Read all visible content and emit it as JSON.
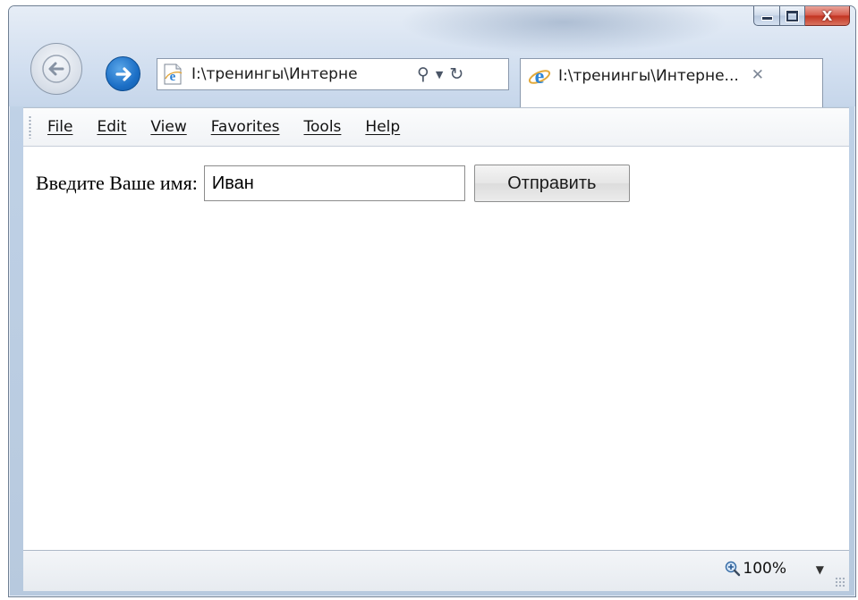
{
  "window": {
    "address_text": "I:\\тренингы\\Интерне",
    "tab_title": "I:\\тренингы\\Интерне...",
    "tab_close_glyph": "✕",
    "caption": {
      "minimize": "",
      "maximize": "",
      "close": "X"
    }
  },
  "menubar": {
    "items": [
      {
        "label": "File"
      },
      {
        "label": "Edit"
      },
      {
        "label": "View"
      },
      {
        "label": "Favorites"
      },
      {
        "label": "Tools"
      },
      {
        "label": "Help"
      }
    ]
  },
  "page": {
    "label": "Введите Ваше имя:",
    "name_value": "Иван",
    "submit_label": "Отправить"
  },
  "statusbar": {
    "zoom": "100%"
  },
  "icons": {
    "back": "back-arrow-icon",
    "forward": "forward-arrow-icon",
    "page": "ie-page-icon",
    "search": "search-icon",
    "refresh": "refresh-icon",
    "zoom": "zoom-icon"
  }
}
